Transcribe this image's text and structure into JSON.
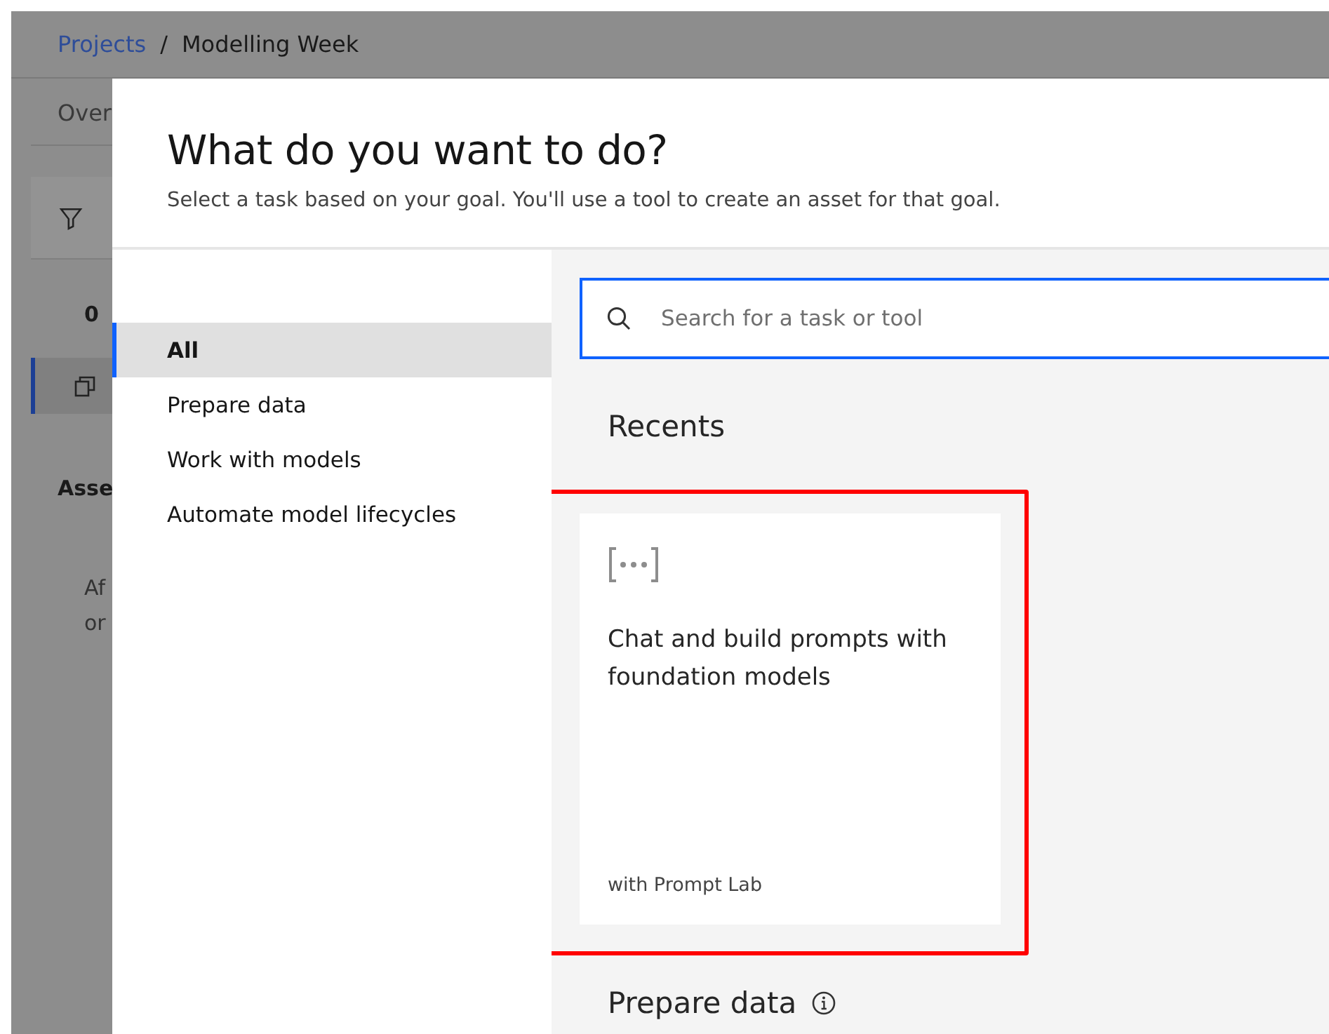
{
  "background_page": {
    "breadcrumb": [
      {
        "label": "Projects",
        "kind": "link"
      },
      {
        "label": "Modelling Week",
        "kind": "current"
      }
    ],
    "separator": "/",
    "tab": "Over",
    "count": "0",
    "section": "Asse",
    "text_lines": [
      "Af",
      "or"
    ]
  },
  "dialog": {
    "title": "What do you want to do?",
    "subtitle": "Select a task based on your goal. You'll use a tool to create an asset for that goal.",
    "nav": [
      {
        "label": "All",
        "selected": true
      },
      {
        "label": "Prepare data",
        "selected": false
      },
      {
        "label": "Work with models",
        "selected": false
      },
      {
        "label": "Automate model lifecycles",
        "selected": false
      }
    ],
    "search": {
      "placeholder": "Search for a task or tool"
    },
    "recents": {
      "heading": "Recents",
      "cards": [
        {
          "title": "Chat and build prompts with foundation models",
          "tool": "with Prompt Lab",
          "highlighted": true
        }
      ]
    },
    "next_section": {
      "heading": "Prepare data"
    }
  }
}
